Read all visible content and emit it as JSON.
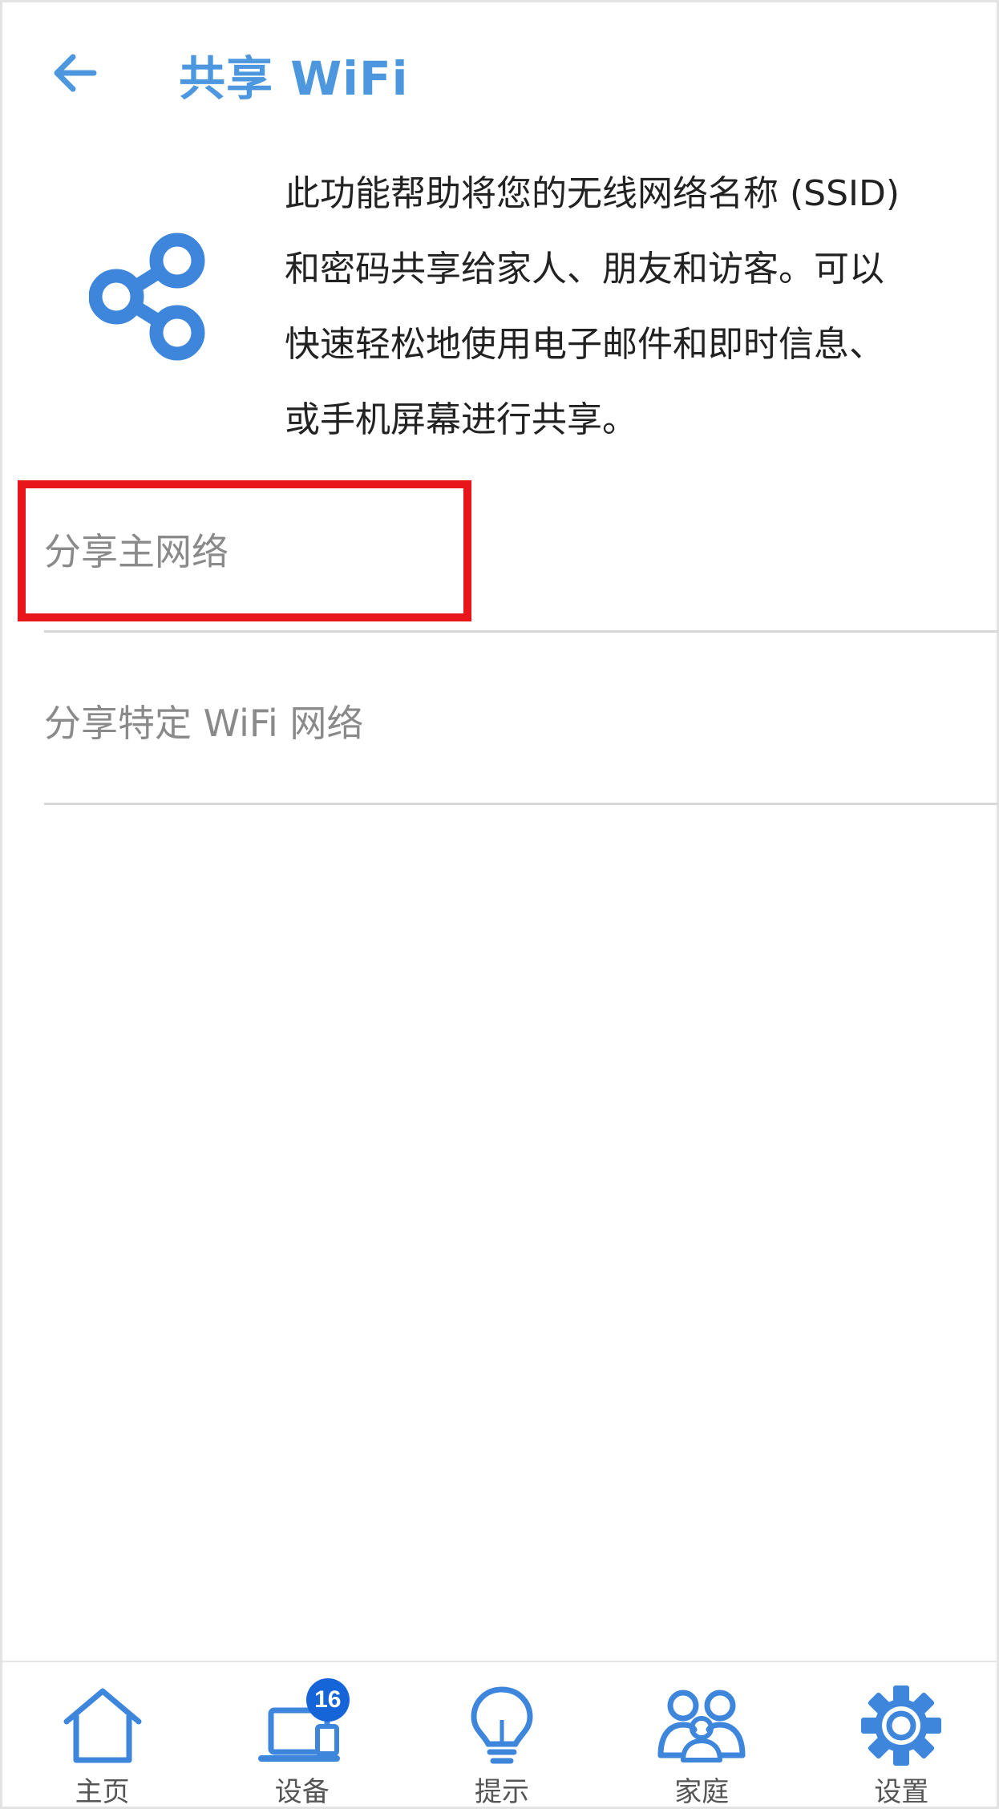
{
  "header": {
    "title": "共享 WiFi",
    "back_icon": "arrow-left-icon"
  },
  "intro": {
    "icon": "share-icon",
    "lines": [
      "此功能帮助将您的无线网络名称 (SSID)",
      "和密码共享给家人、朋友和访客。可以",
      "快速轻松地使用电子邮件和即时信息、",
      "或手机屏幕进行共享。"
    ]
  },
  "options": {
    "share_main": "分享主网络",
    "share_specific": "分享特定 WiFi 网络"
  },
  "bottom_nav": {
    "home": "主页",
    "devices": "设备",
    "devices_badge": "16",
    "tips": "提示",
    "family": "家庭",
    "settings": "设置"
  },
  "colors": {
    "accent": "#4c97de",
    "highlight": "#e8151b",
    "badge": "#1565d8"
  }
}
